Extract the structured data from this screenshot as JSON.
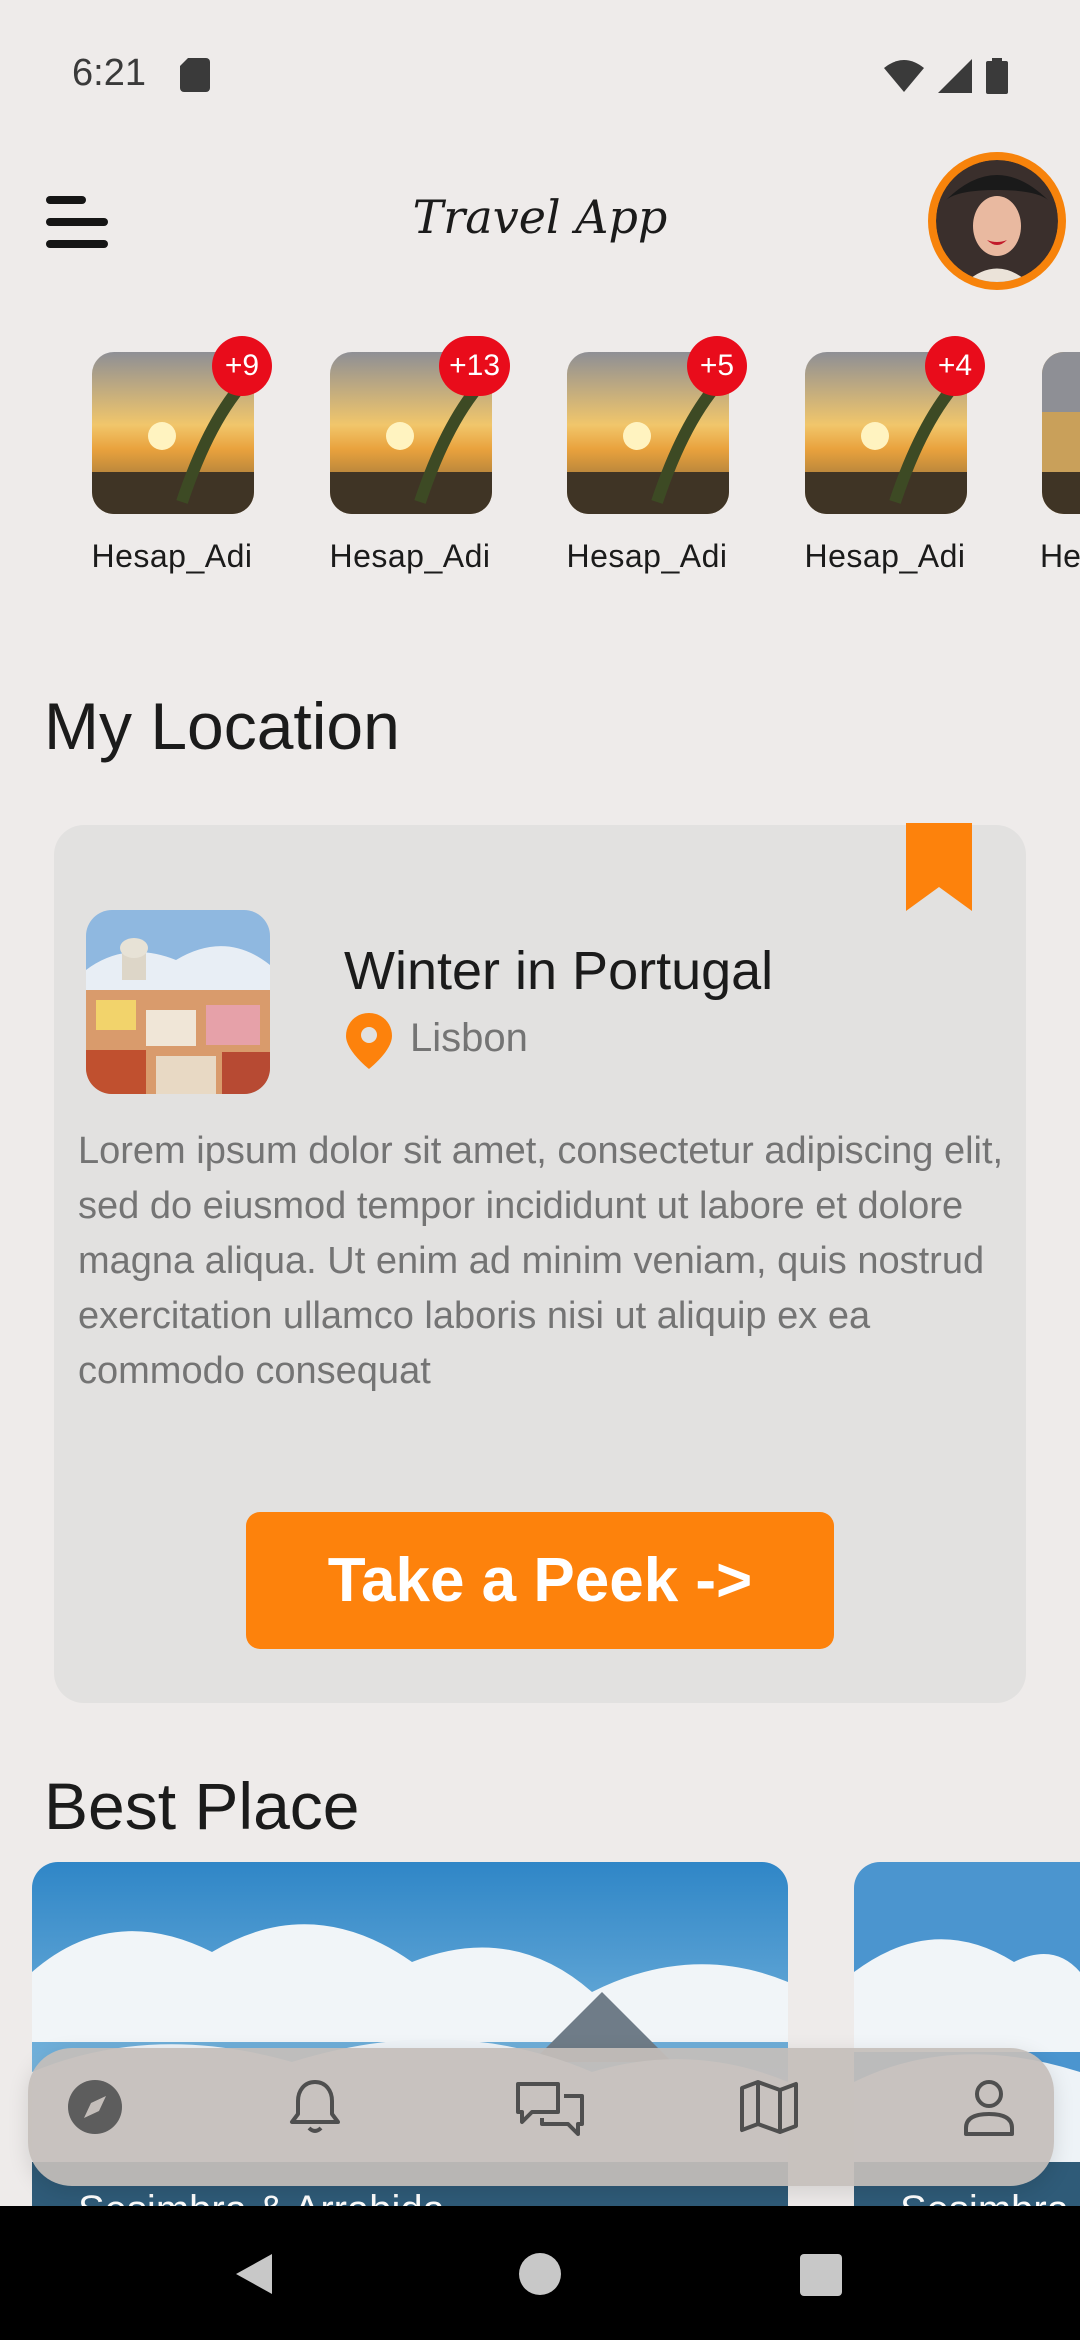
{
  "status_bar": {
    "time": "6:21",
    "icons": [
      "sd-card-icon",
      "wifi-icon",
      "signal-icon",
      "battery-icon"
    ]
  },
  "header": {
    "title": "Travel App",
    "menu_icon": "menu-icon",
    "avatar": "user-avatar"
  },
  "stories": [
    {
      "name": "Hesap_Adi",
      "badge": "+9"
    },
    {
      "name": "Hesap_Adi",
      "badge": "+13"
    },
    {
      "name": "Hesap_Adi",
      "badge": "+5"
    },
    {
      "name": "Hesap_Adi",
      "badge": "+4"
    },
    {
      "name": "Hesap_Adi",
      "badge": ""
    }
  ],
  "my_location": {
    "section_title": "My Location",
    "card": {
      "title": "Winter in Portugal",
      "city": "Lisbon",
      "description": "Lorem ipsum dolor sit amet, consectetur adipiscing elit, sed do eiusmod tempor incididunt ut labore et dolore magna aliqua. Ut enim ad minim veniam, quis nostrud exercitation ullamco laboris nisi ut aliquip ex ea commodo consequat",
      "button_label": "Take a Peek ->",
      "bookmark_icon": "bookmark-icon"
    }
  },
  "best_place": {
    "section_title": "Best Place",
    "cards": [
      {
        "label": "Sesimbra & Arrabida"
      },
      {
        "label": "Sesimbra & Arrabida"
      }
    ]
  },
  "bottom_nav": {
    "items": [
      "compass-icon",
      "bell-icon",
      "chat-icon",
      "map-icon",
      "person-icon"
    ],
    "active": "compass-icon"
  },
  "colors": {
    "accent": "#fd820c",
    "badge": "#e90c1b",
    "background": "#eeebea",
    "card": "#e2e1e0"
  }
}
